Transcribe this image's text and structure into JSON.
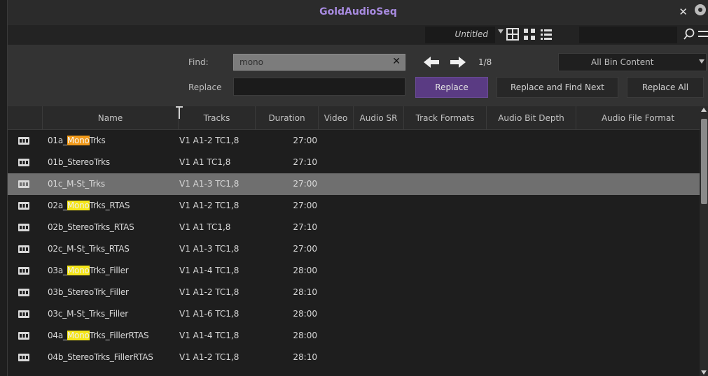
{
  "window": {
    "title": "GoldAudioSeq"
  },
  "bin": {
    "name": "Untitled"
  },
  "find": {
    "find_label": "Find:",
    "find_value": "mono",
    "replace_label": "Replace",
    "replace_value": "",
    "counter": "1/8",
    "scope": "All Bin Content",
    "replace_button": "Replace",
    "replace_find_next_button": "Replace and Find Next",
    "replace_all_button": "Replace All"
  },
  "columns": [
    "Name",
    "Tracks",
    "Duration",
    "Video",
    "Audio SR",
    "Track Formats",
    "Audio Bit Depth",
    "Audio File Format"
  ],
  "rows": [
    {
      "pre": "01a_",
      "match": "Mono",
      "post": "Trks",
      "tracks": "V1 A1-2 TC1,8",
      "duration": "27:00",
      "highlight": "orange"
    },
    {
      "pre": "01b_StereoTrks",
      "match": "",
      "post": "",
      "tracks": "V1 A1 TC1,8",
      "duration": "27:10"
    },
    {
      "pre": "01c_M-St_Trks",
      "match": "",
      "post": "",
      "tracks": "V1 A1-3 TC1,8",
      "duration": "27:00",
      "selected": true
    },
    {
      "pre": "02a_",
      "match": "Mono",
      "post": "Trks_RTAS",
      "tracks": "V1 A1-2 TC1,8",
      "duration": "27:00",
      "highlight": "yellow"
    },
    {
      "pre": "02b_StereoTrks_RTAS",
      "match": "",
      "post": "",
      "tracks": "V1 A1 TC1,8",
      "duration": "27:10"
    },
    {
      "pre": "02c_M-St_Trks_RTAS",
      "match": "",
      "post": "",
      "tracks": "V1 A1-3 TC1,8",
      "duration": "27:00"
    },
    {
      "pre": "03a_",
      "match": "Mono",
      "post": "Trks_Filler",
      "tracks": "V1 A1-4 TC1,8",
      "duration": "28:00",
      "highlight": "yellow"
    },
    {
      "pre": "03b_StereoTrk_Filler",
      "match": "",
      "post": "",
      "tracks": "V1 A1-2 TC1,8",
      "duration": "28:10"
    },
    {
      "pre": "03c_M-St_Trks_Filler",
      "match": "",
      "post": "",
      "tracks": "V1 A1-6 TC1,8",
      "duration": "28:00"
    },
    {
      "pre": "04a_",
      "match": "Mono",
      "post": "Trks_FillerRTAS",
      "tracks": "V1 A1-4 TC1,8",
      "duration": "28:00",
      "highlight": "yellow"
    },
    {
      "pre": "04b_StereoTrks_FillerRTAS",
      "match": "",
      "post": "",
      "tracks": "V1 A1-2 TC1,8",
      "duration": "28:10"
    }
  ],
  "colors": {
    "title": "#a88be0",
    "replace_button": "#5a3b83",
    "current_match": "#f19a1a",
    "other_match": "#f5e61a",
    "selected_row": "#6f6f6f"
  }
}
